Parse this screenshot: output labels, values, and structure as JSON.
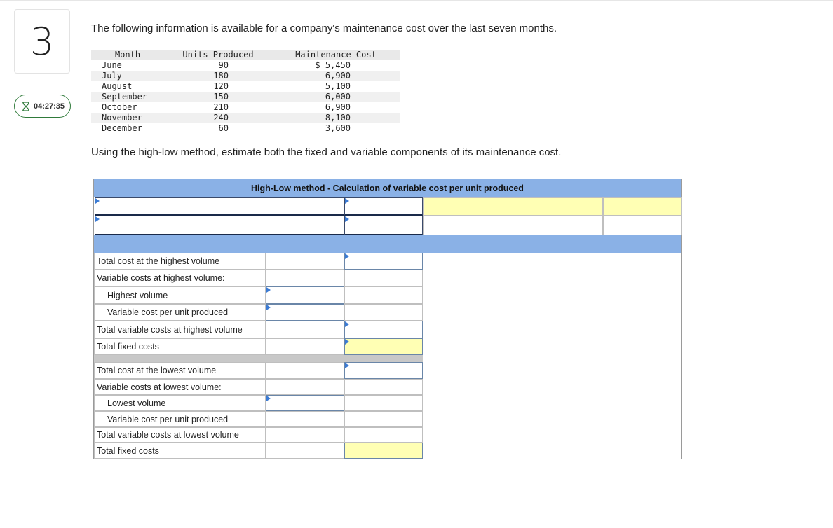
{
  "question": {
    "number": "3",
    "timer": "04:27:35",
    "intro": "The following information is available for a company's maintenance cost over the last seven months.",
    "instruction": "Using the high-low method, estimate both the fixed and variable components of its maintenance cost."
  },
  "data_table": {
    "headers": [
      "Month",
      "Units Produced",
      "Maintenance Cost"
    ],
    "rows": [
      {
        "month": "June",
        "units": "90",
        "cost": "$ 5,450"
      },
      {
        "month": "July",
        "units": "180",
        "cost": "6,900"
      },
      {
        "month": "August",
        "units": "120",
        "cost": "5,100"
      },
      {
        "month": "September",
        "units": "150",
        "cost": "6,000"
      },
      {
        "month": "October",
        "units": "210",
        "cost": "6,900"
      },
      {
        "month": "November",
        "units": "240",
        "cost": "8,100"
      },
      {
        "month": "December",
        "units": "60",
        "cost": "3,600"
      }
    ]
  },
  "worksheet": {
    "title": "High-Low method - Calculation of variable cost per unit produced",
    "high_section": [
      "Total cost at the highest volume",
      "Variable costs at highest volume:",
      "Highest volume",
      "Variable cost per unit produced",
      "Total variable costs at highest volume",
      "Total fixed costs"
    ],
    "low_section": [
      "Total cost at the lowest volume",
      "Variable costs at lowest volume:",
      "Lowest volume",
      "Variable cost per unit produced",
      "Total variable costs at lowest volume",
      "Total fixed costs"
    ]
  },
  "colors": {
    "header_blue": "#8ab1e6",
    "answer_yellow": "#ffffb4",
    "timer_border": "#2f7a3a"
  }
}
